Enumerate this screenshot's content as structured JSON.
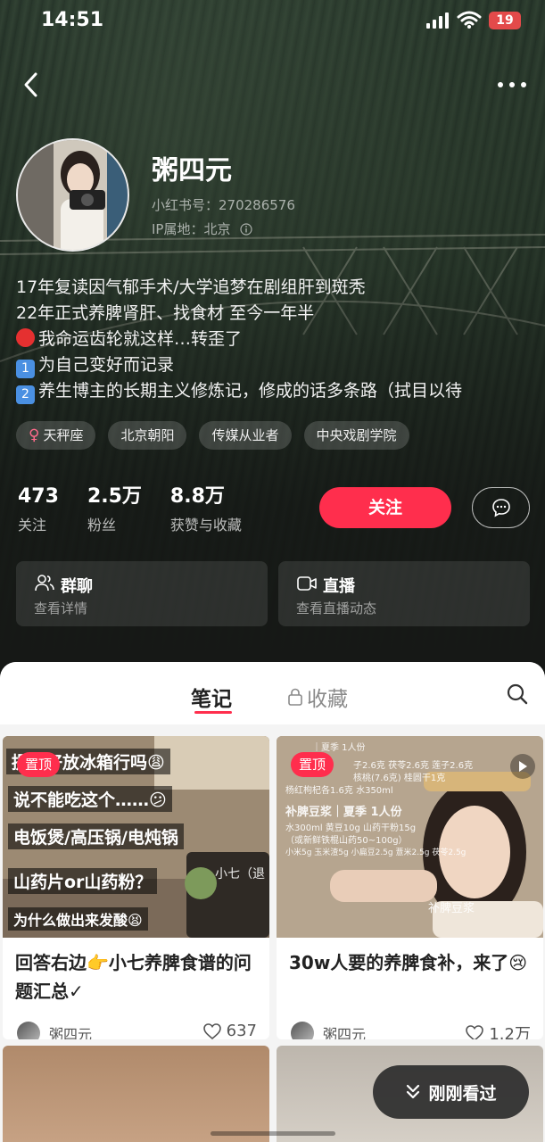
{
  "status_bar": {
    "time": "14:51",
    "battery": "19"
  },
  "profile": {
    "nickname": "粥四元",
    "red_id": "小红书号：270286576",
    "ip_location": "IP属地：北京"
  },
  "bio": {
    "line1": "17年复读因气郁手术/大学追梦在剧组肝到斑秃",
    "line2": "22年正式养脾肾肝、找食材 至今一年半",
    "line3": "我命运齿轮就这样…转歪了",
    "line4": "为自己变好而记录",
    "line5": "养生博主的长期主义修炼记，修成的话多条路（拭目以待",
    "badge1": "1",
    "badge2": "2"
  },
  "tags": [
    {
      "label": "天秤座",
      "icon": "female-icon"
    },
    {
      "label": "北京朝阳"
    },
    {
      "label": "传媒从业者"
    },
    {
      "label": "中央戏剧学院"
    }
  ],
  "stats": [
    {
      "value": "473",
      "label": "关注"
    },
    {
      "value": "2.5万",
      "label": "粉丝"
    },
    {
      "value": "8.8万",
      "label": "获赞与收藏"
    }
  ],
  "actions": {
    "follow": "关注"
  },
  "cards": {
    "group": {
      "title": "群聊",
      "subtitle": "查看详情"
    },
    "live": {
      "title": "直播",
      "subtitle": "查看直播动态"
    }
  },
  "tabs": {
    "notes": "笔记",
    "favorites": "收藏"
  },
  "notes": [
    {
      "pin": "置顶",
      "cover_lines": [
        "提前好放冰箱行吗😩",
        "说不能吃这个……😕",
        "电饭煲/高压锅/电炖锅",
        "山药片or山药粉？",
        "为什么做出来发酸😫"
      ],
      "cover_side": "小七（退",
      "title": "回答右边👉小七养脾食谱的问题汇总✓",
      "author": "粥四元",
      "likes": "637"
    },
    {
      "pin": "置顶",
      "cover_lines": [
        "补脾豆浆｜夏季 1人份",
        "水300ml 黄豆10g 山药干粉15g",
        "（或新鲜铁棍山药50~100g）",
        "小米5g 玉米渣5g 小扁豆2.5g 薏米2.5g 茯苓2.5g",
        "补脾豆浆"
      ],
      "cover_top": [
        "｜夏季 1人份",
        "子2.6克 茯苓2.6克 莲子2.6克",
        "核桃(7.6克) 桂圆干1克",
        "杨红枸杞各1.6克 水350ml"
      ],
      "title": "30w人要的养脾食补，来了😢",
      "author": "粥四元",
      "likes": "1.2万"
    }
  ],
  "floating": {
    "just_seen": "刚刚看过"
  }
}
